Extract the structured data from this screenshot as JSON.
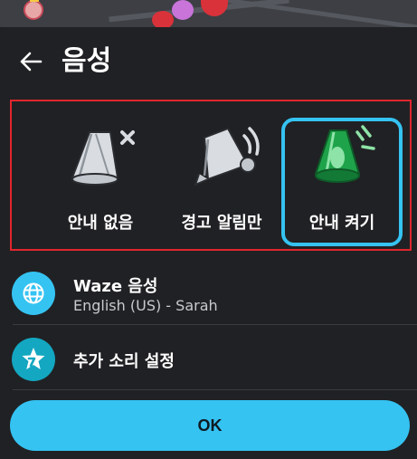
{
  "header": {
    "title": "음성"
  },
  "modes": [
    {
      "id": "none",
      "label": "안내 없음",
      "icon": "speaker-muted-icon",
      "selected": false
    },
    {
      "id": "alerts",
      "label": "경고 알림만",
      "icon": "speaker-alerts-icon",
      "selected": false
    },
    {
      "id": "on",
      "label": "안내 켜기",
      "icon": "speaker-on-icon",
      "selected": true
    }
  ],
  "voice": {
    "title": "Waze 음성",
    "subtitle": "English (US) - Sarah",
    "icon": "globe-icon"
  },
  "sound": {
    "title": "추가 소리 설정",
    "icon": "sound-star-icon"
  },
  "ok_button": {
    "label": "OK"
  },
  "colors": {
    "accent": "#35c3f2",
    "selected_speaker": "#1fa34a",
    "highlight_frame": "#e0262e",
    "background": "#202124"
  }
}
